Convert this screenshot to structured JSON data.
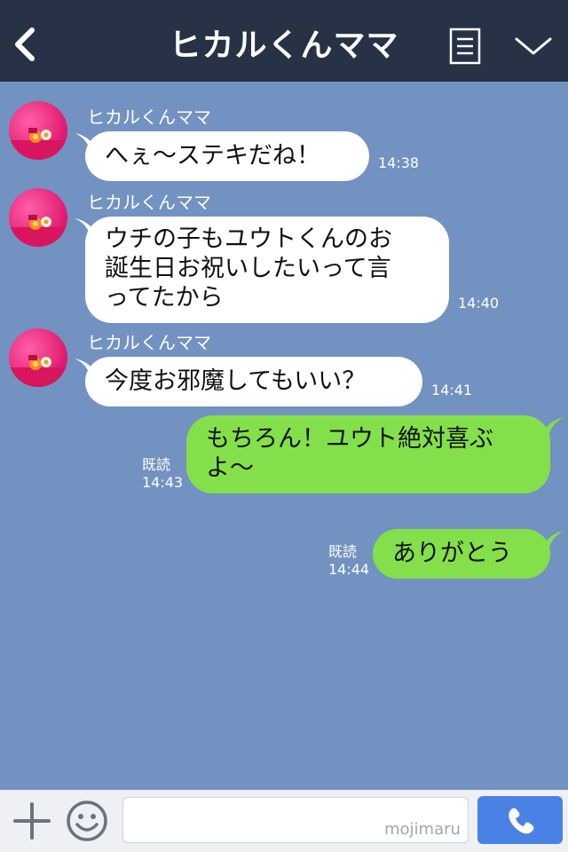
{
  "header": {
    "title": "ヒカルくんママ",
    "back_icon": "chevron-left-icon",
    "menu_icon": "menu-icon",
    "dropdown_icon": "chevron-down-icon",
    "background": "#273246"
  },
  "chat": {
    "background": "#7292c1",
    "messages": [
      {
        "sender": "ヒカルくんママ",
        "direction": "incoming",
        "lines": [
          "へぇ〜ステキだね！"
        ],
        "time": "14:38"
      },
      {
        "sender": "ヒカルくんママ",
        "direction": "incoming",
        "lines": [
          "ウチの子もユウトくんのお",
          "誕生日お祝いしたいって言",
          "ってたから"
        ],
        "time": "14:40"
      },
      {
        "sender": "ヒカルくんママ",
        "direction": "incoming",
        "lines": [
          "今度お邪魔してもいい？"
        ],
        "time": "14:41"
      },
      {
        "direction": "outgoing",
        "lines": [
          "もちろん！ユウト絶対喜ぶ",
          "よ〜"
        ],
        "read": "既読",
        "time": "14:43"
      },
      {
        "direction": "outgoing",
        "lines": [
          "ありがとう"
        ],
        "read": "既読",
        "time": "14:44"
      }
    ]
  },
  "input_bar": {
    "plus_icon": "plus-icon",
    "emoji_icon": "smiley-icon",
    "input_value": "",
    "watermark": "mojimaru",
    "call_icon": "phone-icon"
  },
  "colors": {
    "incoming_bubble": "#ffffff",
    "outgoing_bubble": "#84e04a",
    "call_button": "#4a81e4"
  }
}
